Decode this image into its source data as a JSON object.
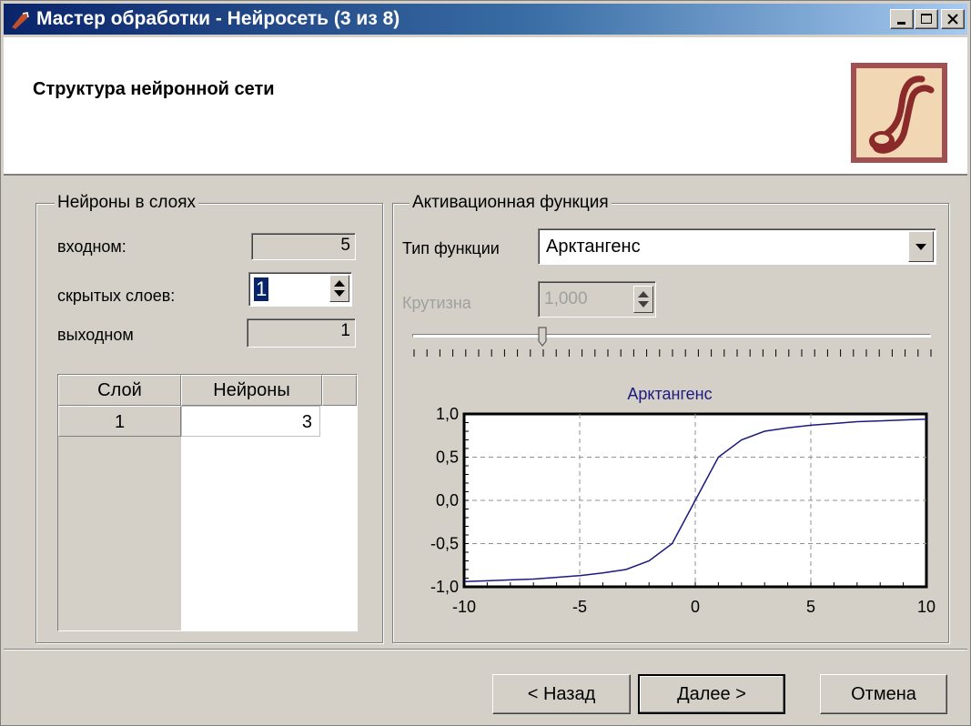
{
  "window": {
    "title": "Мастер обработки - Нейросеть (3 из 8)"
  },
  "header": {
    "heading": "Структура нейронной сети"
  },
  "neurons_group": {
    "title": "Нейроны в слоях",
    "input_label": "входном:",
    "input_value": "5",
    "hidden_label": "скрытых слоев:",
    "hidden_value": "1",
    "output_label": "выходном",
    "output_value": "1",
    "table": {
      "headers": [
        "Слой",
        "Нейроны"
      ],
      "rows": [
        {
          "layer": "1",
          "neurons": "3"
        }
      ]
    }
  },
  "activation_group": {
    "title": "Активационная функция",
    "type_label": "Тип функции",
    "type_value": "Арктангенс",
    "steepness_label": "Крутизна",
    "steepness_value": "1,000",
    "slider_fraction": 0.25
  },
  "chart_data": {
    "type": "line",
    "title": "Арктангенс",
    "xlim": [
      -10,
      10
    ],
    "ylim": [
      -1,
      1
    ],
    "x_ticks": [
      "-10",
      "-5",
      "0",
      "5",
      "10"
    ],
    "y_ticks": [
      "1,0",
      "0,5",
      "0,0",
      "-0,5",
      "-1,0"
    ],
    "grid": true,
    "series": [
      {
        "x": [
          -10,
          -9,
          -8,
          -7,
          -6,
          -5,
          -4,
          -3,
          -2,
          -1,
          0,
          1,
          2,
          3,
          4,
          5,
          6,
          7,
          8,
          9,
          10
        ],
        "y": [
          -0.94,
          -0.93,
          -0.92,
          -0.91,
          -0.89,
          -0.87,
          -0.84,
          -0.8,
          -0.7,
          -0.5,
          0,
          0.5,
          0.7,
          0.8,
          0.84,
          0.87,
          0.89,
          0.91,
          0.92,
          0.93,
          0.94
        ],
        "color": "#1a1a80"
      }
    ]
  },
  "buttons": {
    "back": "< Назад",
    "next": "Далее >",
    "cancel": "Отмена"
  }
}
